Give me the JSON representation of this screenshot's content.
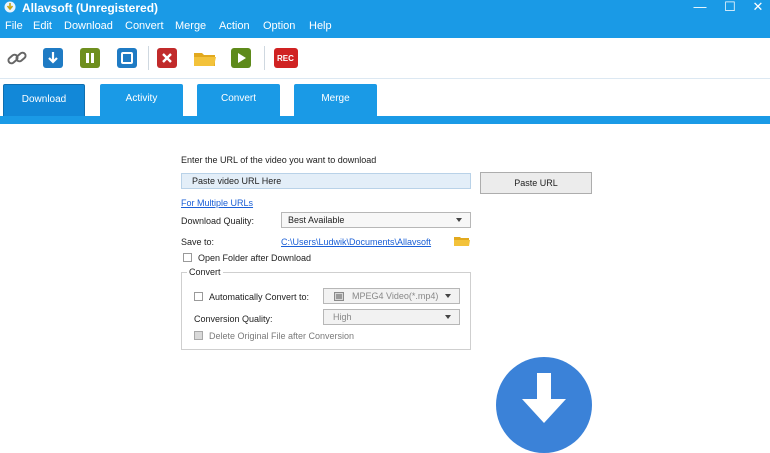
{
  "window": {
    "title": "Allavsoft (Unregistered)",
    "minimize": "—",
    "maximize": "☐",
    "close": "✕"
  },
  "menu": [
    "File",
    "Edit",
    "Download",
    "Convert",
    "Merge",
    "Action",
    "Option",
    "Help"
  ],
  "toolbar": {
    "icons": [
      "link-icon",
      "download-icon",
      "pause-icon",
      "stop-icon",
      "delete-icon",
      "folder-icon",
      "play-icon",
      "rec-icon"
    ],
    "rec_label": "REC"
  },
  "tabs": [
    "Download",
    "Activity",
    "Convert",
    "Merge"
  ],
  "form": {
    "url_prompt": "Enter the URL of the video you want to download",
    "url_placeholder": "Paste video URL Here",
    "paste_button": "Paste URL",
    "multiple_urls_link": "For Multiple URLs",
    "quality_label": "Download Quality:",
    "quality_value": "Best Available",
    "save_label": "Save to:",
    "save_path": "C:\\Users\\Ludwik\\Documents\\Allavsoft",
    "open_folder_label": "Open Folder after Download",
    "convert_group": "Convert",
    "auto_convert_label": "Automatically Convert to:",
    "auto_convert_value": "MPEG4 Video(*.mp4)",
    "conv_quality_label": "Conversion Quality:",
    "conv_quality_value": "High",
    "delete_original_label": "Delete Original File after Conversion"
  },
  "colors": {
    "accent": "#1a9ae6",
    "download_circle": "#3b82d8"
  }
}
